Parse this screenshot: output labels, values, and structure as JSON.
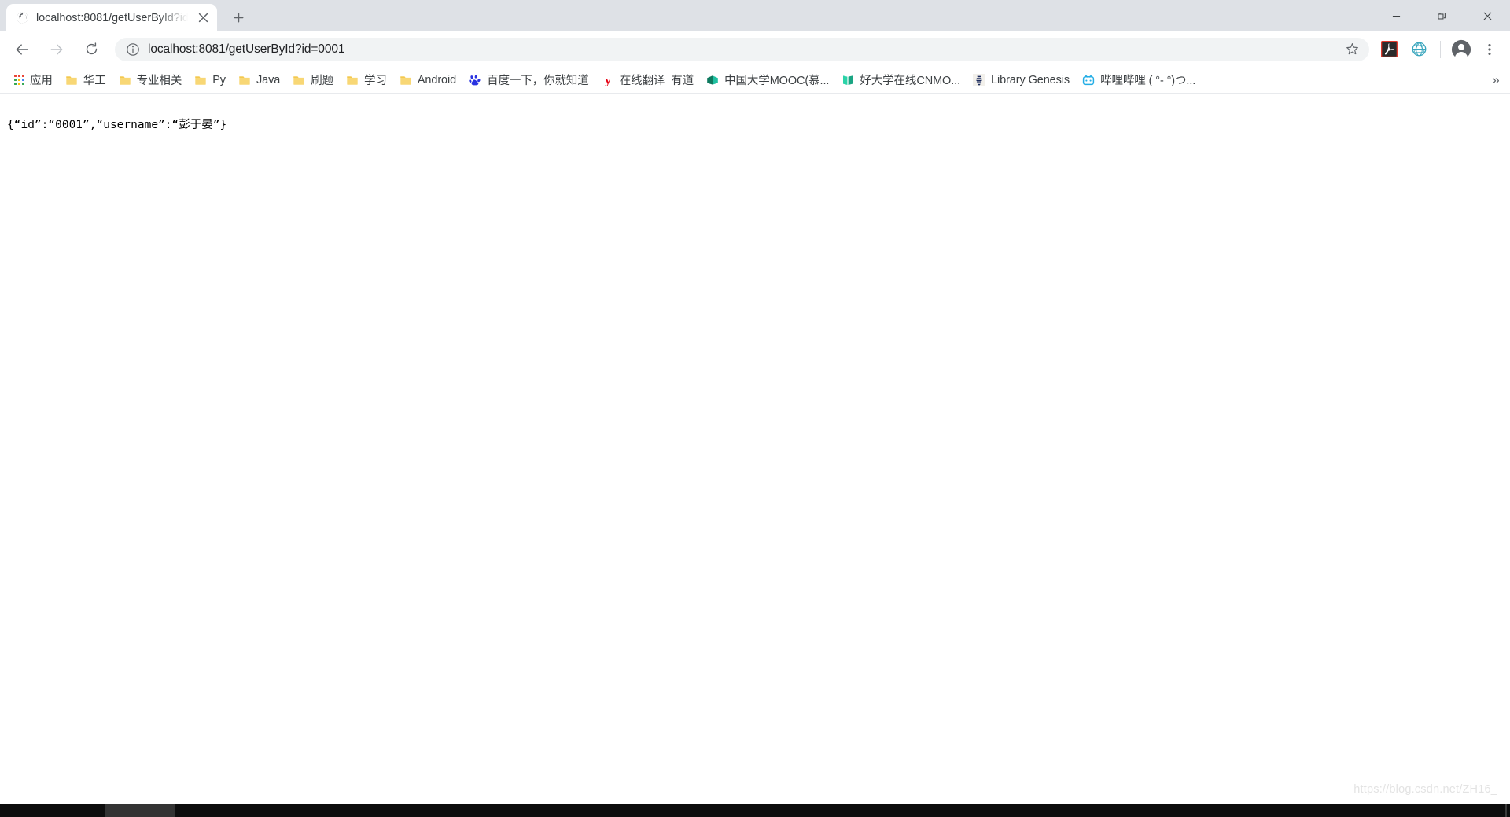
{
  "window": {
    "minimize_label": "Minimize",
    "restore_label": "Restore",
    "close_label": "Close"
  },
  "tabstrip": {
    "tabs": [
      {
        "title": "localhost:8081/getUserById?id",
        "favicon": "globe-icon",
        "active": true,
        "close_label": "×"
      }
    ],
    "new_tab_label": "+"
  },
  "toolbar": {
    "back_label": "Back",
    "forward_label": "Forward",
    "reload_label": "Reload",
    "info_icon": "page-info-icon",
    "url": "localhost:8081/getUserById?id=0001",
    "bookmark_star_label": "Bookmark this tab",
    "extensions": [
      {
        "name": "adobe-acrobat-extension",
        "glyph": "A"
      },
      {
        "name": "webgl-globe-extension",
        "glyph": "⬡"
      }
    ],
    "profile_label": "Profile",
    "menu_label": "Customize and control Google Chrome"
  },
  "bookmarks": {
    "apps_label": "应用",
    "overflow_label": "»",
    "items": [
      {
        "label": "华工",
        "icon": "folder-icon"
      },
      {
        "label": "专业相关",
        "icon": "folder-icon"
      },
      {
        "label": "Py",
        "icon": "folder-icon"
      },
      {
        "label": "Java",
        "icon": "folder-icon"
      },
      {
        "label": "刷题",
        "icon": "folder-icon"
      },
      {
        "label": "学习",
        "icon": "folder-icon"
      },
      {
        "label": "Android",
        "icon": "folder-icon"
      },
      {
        "label": "百度一下，你就知道",
        "icon": "baidu-icon"
      },
      {
        "label": "在线翻译_有道",
        "icon": "youdao-icon"
      },
      {
        "label": "中国大学MOOC(慕...",
        "icon": "mooc-icon"
      },
      {
        "label": "好大学在线CNMO...",
        "icon": "cnmooc-icon"
      },
      {
        "label": "Library Genesis",
        "icon": "libgen-icon"
      },
      {
        "label": "哔哩哔哩 ( °- °)つ...",
        "icon": "bilibili-icon"
      }
    ]
  },
  "page": {
    "body_text": "{“id”:“0001”,“username”:“彭于晏”}",
    "watermark": "https://blog.csdn.net/ZH16_"
  },
  "taskbar": {
    "clock": ""
  },
  "colors": {
    "tabstrip_bg": "#dee1e6",
    "toolbar_bg": "#ffffff",
    "omnibox_bg": "#f1f3f4",
    "text": "#3c4043",
    "folder_yellow": "#fbd34d",
    "accent_blue": "#1a73e8"
  }
}
